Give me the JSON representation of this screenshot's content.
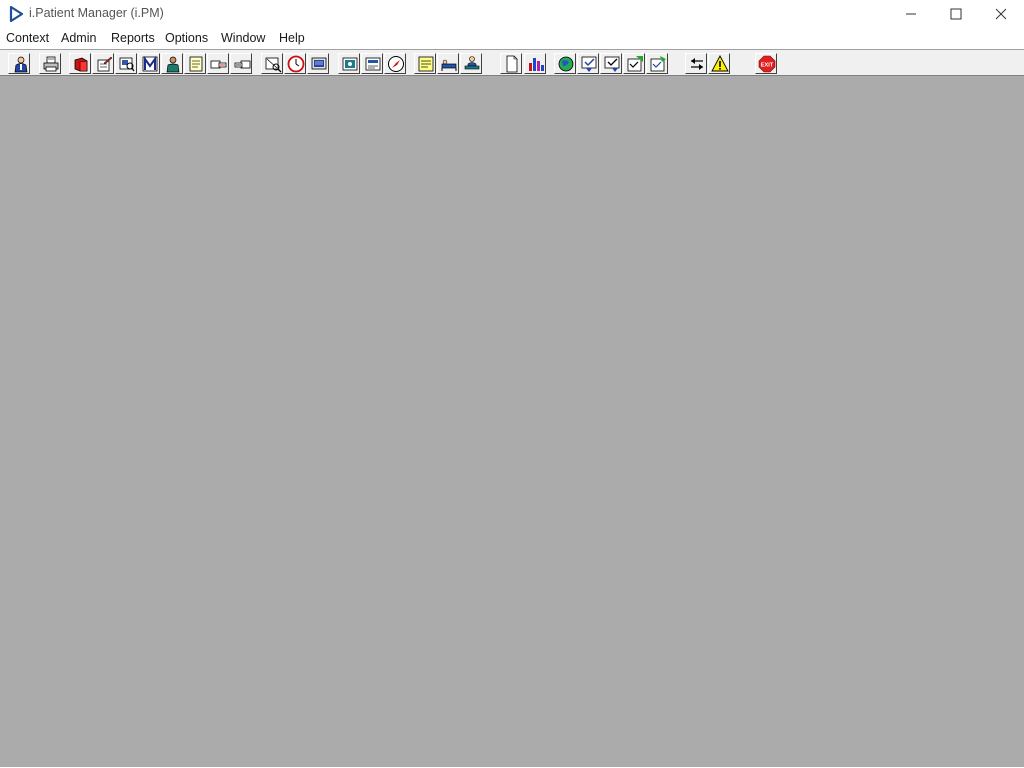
{
  "window": {
    "title": "i.Patient Manager (i.PM)",
    "icon": "play-arrow-icon",
    "controls": [
      "minimize",
      "maximize",
      "close"
    ]
  },
  "menu": {
    "items": [
      "Context",
      "Admin",
      "Reports",
      "Options",
      "Window",
      "Help"
    ]
  },
  "toolbar": {
    "buttons": [
      {
        "icon": "patient-icon"
      },
      {
        "icon": "printer-icon"
      },
      {
        "icon": "book-icon"
      },
      {
        "icon": "edit-document-icon"
      },
      {
        "icon": "search-document-icon"
      },
      {
        "icon": "m-letter-icon"
      },
      {
        "icon": "doctor-icon"
      },
      {
        "icon": "notes-icon"
      },
      {
        "icon": "hand-point-left-icon"
      },
      {
        "icon": "hand-point-right-icon"
      },
      {
        "icon": "document-search-icon"
      },
      {
        "icon": "clock-icon"
      },
      {
        "icon": "monitor-icon"
      },
      {
        "icon": "camera-icon"
      },
      {
        "icon": "card-icon"
      },
      {
        "icon": "compass-icon"
      },
      {
        "icon": "memo-icon"
      },
      {
        "icon": "bed-icon"
      },
      {
        "icon": "patient-bed-icon"
      },
      {
        "icon": "blank-page-icon"
      },
      {
        "icon": "bar-chart-icon"
      },
      {
        "icon": "globe-icon"
      },
      {
        "icon": "checklist-icon"
      },
      {
        "icon": "checklist-down-icon"
      },
      {
        "icon": "checklist-green-icon"
      },
      {
        "icon": "checklist-refresh-icon"
      },
      {
        "icon": "swap-arrows-icon"
      },
      {
        "icon": "warning-icon"
      },
      {
        "icon": "exit-icon"
      }
    ],
    "exit_label": "EXIT"
  },
  "colors": {
    "workspace": "#ababab",
    "toolbar": "#f0f0f0",
    "title_icon": "#1f4e9c",
    "exit": "#e02020"
  }
}
